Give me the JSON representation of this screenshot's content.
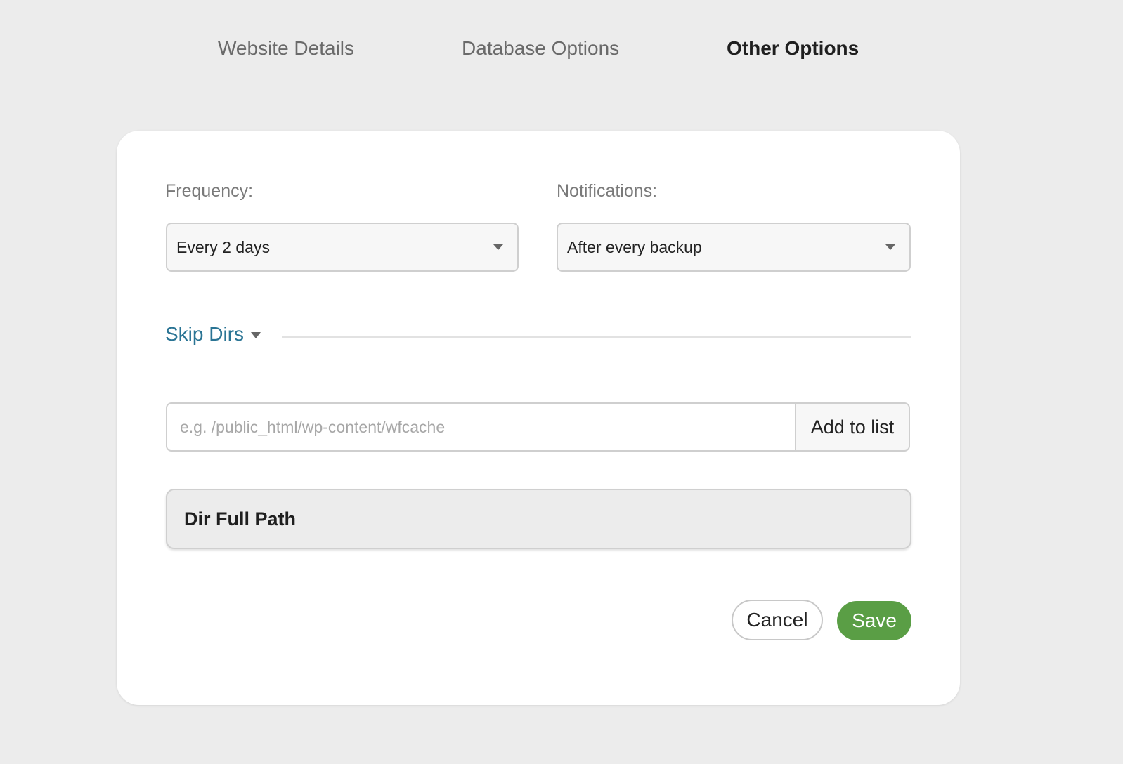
{
  "tabs": [
    {
      "label": "Website Details",
      "active": false
    },
    {
      "label": "Database Options",
      "active": false
    },
    {
      "label": "Other Options",
      "active": true
    }
  ],
  "form": {
    "frequency": {
      "label": "Frequency:",
      "selected": "Every 2 days"
    },
    "notifications": {
      "label": "Notifications:",
      "selected": "After every backup"
    },
    "skip_dirs": {
      "title": "Skip Dirs",
      "input_value": "",
      "input_placeholder": "e.g. /public_html/wp-content/wfcache",
      "add_button_label": "Add to list",
      "table_columns": [
        "Dir Full Path"
      ],
      "rows": []
    }
  },
  "actions": {
    "cancel_label": "Cancel",
    "save_label": "Save"
  },
  "colors": {
    "background": "#ececec",
    "link": "#2a7494",
    "save_button": "#5a9e45"
  },
  "icons": {
    "select_caret": "chevron-down-icon",
    "section_caret": "chevron-down-icon"
  }
}
